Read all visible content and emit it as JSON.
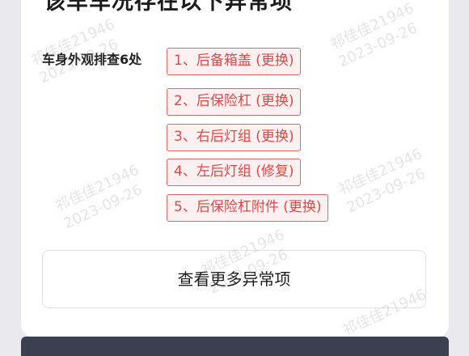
{
  "header": {
    "partial_title": "该车车况存在以下异常项"
  },
  "section": {
    "label": "车身外观排查6处",
    "items": [
      "1、后备箱盖 (更换)",
      "2、后保险杠 (更换)",
      "3、右后灯组 (更换)",
      "4、左后灯组 (修复)",
      "5、后保险杠附件 (更换)"
    ]
  },
  "more_button": {
    "label": "查看更多异常项"
  },
  "watermark": {
    "name": "祁佳佳21946",
    "date": "2023-09-26"
  },
  "colors": {
    "issue_text": "#e04848",
    "issue_border": "#e06666",
    "issue_bg": "#fdf0f0",
    "bottom_bar": "#3b3f50"
  }
}
